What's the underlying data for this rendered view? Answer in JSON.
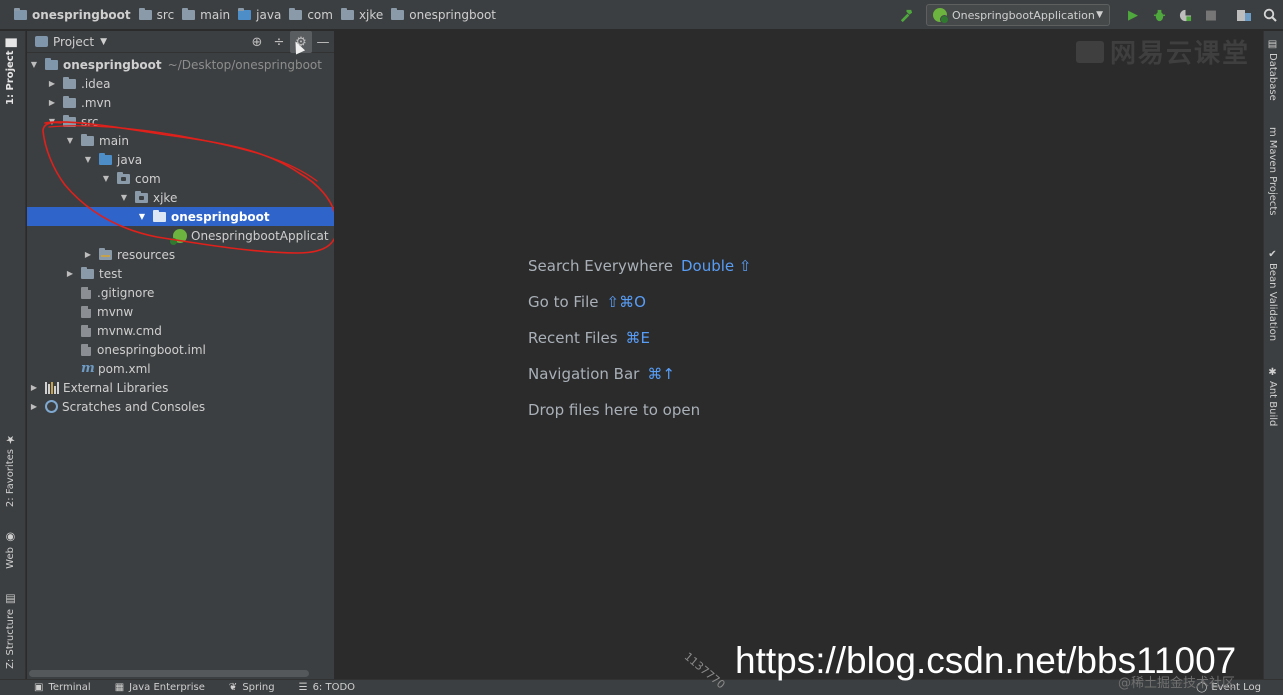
{
  "breadcrumbs": [
    {
      "label": "onespringboot",
      "kind": "project"
    },
    {
      "label": "src",
      "kind": "folder"
    },
    {
      "label": "main",
      "kind": "folder"
    },
    {
      "label": "java",
      "kind": "folder"
    },
    {
      "label": "com",
      "kind": "folder"
    },
    {
      "label": "xjke",
      "kind": "folder"
    },
    {
      "label": "onespringboot",
      "kind": "folder"
    }
  ],
  "toolbar": {
    "run_config": "OnespringbootApplication",
    "icons": [
      "build-hammer-icon",
      "run-icon",
      "debug-icon",
      "coverage-icon",
      "stop-icon",
      "project-structure-icon",
      "search-icon"
    ]
  },
  "left_tool_tabs": {
    "project": "1: Project",
    "favorites": "2: Favorites",
    "web": "Web",
    "structure": "Z: Structure"
  },
  "right_tool_tabs": {
    "database": "Database",
    "maven": "Maven Projects",
    "bean": "Bean Validation",
    "ant": "Ant Build"
  },
  "project_panel": {
    "title": "Project",
    "tree": {
      "root": "onespringboot",
      "root_path": "~/Desktop/onespringboot",
      "idea": ".idea",
      "mvn": ".mvn",
      "src": "src",
      "main": "main",
      "java": "java",
      "com": "com",
      "xjke": "xjke",
      "pkg": "onespringboot",
      "app_class": "OnespringbootApplicat",
      "resources": "resources",
      "test": "test",
      "gitignore": ".gitignore",
      "mvnw": "mvnw",
      "mvnw_cmd": "mvnw.cmd",
      "iml": "onespringboot.iml",
      "pom": "pom.xml",
      "external_libraries": "External Libraries",
      "scratches": "Scratches and Consoles"
    },
    "selected": "onespringboot"
  },
  "editor_hints": {
    "search_everywhere": {
      "label": "Search Everywhere",
      "key": "Double ⇧"
    },
    "go_to_file": {
      "label": "Go to File",
      "key": "⇧⌘O"
    },
    "recent_files": {
      "label": "Recent Files",
      "key": "⌘E"
    },
    "navigation_bar": {
      "label": "Navigation Bar",
      "key": "⌘↑"
    },
    "drop_files": {
      "label": "Drop files here to open"
    }
  },
  "watermark": "网易云课堂",
  "bottom_tabs": {
    "terminal": "Terminal",
    "java_enterprise": "Java Enterprise",
    "spring": "Spring",
    "todo": "6: TODO",
    "event_log": "Event Log"
  },
  "overlay": {
    "csdn_url": "https://blog.csdn.net/bbs11007",
    "juejin": "@稀土掘金技术社区",
    "diagonal_id": "1137770"
  },
  "colors": {
    "selection": "#2f65ca",
    "accent_key": "#589df6",
    "annotation": "#e0201b",
    "run_green": "#4fa83d"
  }
}
